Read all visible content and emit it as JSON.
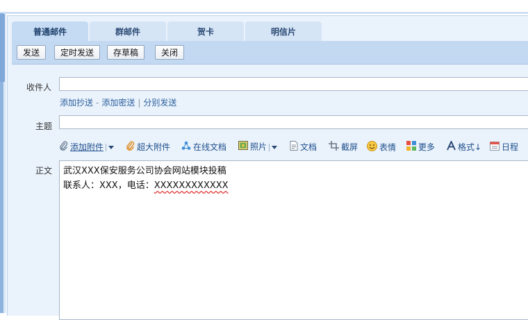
{
  "tabs": [
    {
      "label": "普通邮件",
      "active": true
    },
    {
      "label": "群邮件",
      "active": false
    },
    {
      "label": "贺卡",
      "active": false
    },
    {
      "label": "明信片",
      "active": false
    }
  ],
  "toolbar": {
    "send": "发送",
    "schedule": "定时发送",
    "save_draft": "存草稿",
    "close": "关闭"
  },
  "form": {
    "recipient_label": "收件人",
    "recipient_value": "",
    "add_cc": "添加抄送",
    "dash": "-",
    "add_bcc": "添加密送",
    "pipe": "|",
    "separate_send": "分别发送",
    "subject_label": "主题",
    "subject_value": "",
    "body_label": "正文"
  },
  "editor_tools": {
    "attach": "添加附件",
    "super_attach": "超大附件",
    "online_doc": "在线文档",
    "photo": "照片",
    "document": "文档",
    "screenshot": "截屏",
    "emoticon": "表情",
    "more": "更多",
    "format": "格式↓",
    "schedule": "日程"
  },
  "body": {
    "line1": "武汉XXX保安服务公司协会网站模块投稿",
    "line2_prefix": "联系人：XXX，电话：",
    "line2_phone": "XXXXXXXXXXXX"
  },
  "colors": {
    "accent": "#2a5f9e",
    "toolbar_bg": "#c3d9f2",
    "panel_bg": "#eaf2fb",
    "spellcheck": "#e23a3a"
  }
}
